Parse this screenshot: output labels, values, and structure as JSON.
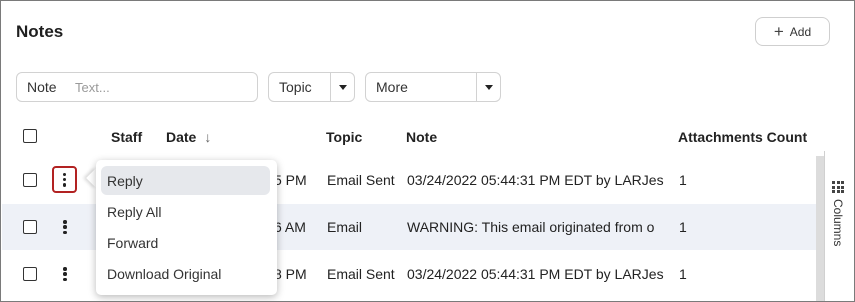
{
  "panel": {
    "title": "Notes",
    "add_label": "Add"
  },
  "filters": {
    "note_label": "Note",
    "note_placeholder": "Text...",
    "topic_label": "Topic",
    "more_label": "More"
  },
  "table": {
    "headers": {
      "staff": "Staff",
      "date": "Date",
      "topic": "Topic",
      "note": "Note",
      "attachments": "Attachments Count"
    },
    "rows": [
      {
        "date": "5 PM",
        "topic": "Email Sent",
        "note": "03/24/2022 05:44:31 PM EDT by LARJes",
        "attachments": "1"
      },
      {
        "date": "6 AM",
        "topic": "Email",
        "note": "WARNING: This email originated from o",
        "attachments": "1"
      },
      {
        "date": "8 PM",
        "topic": "Email Sent",
        "note": "03/24/2022 05:44:31 PM EDT by LARJes",
        "attachments": "1"
      }
    ]
  },
  "context_menu": {
    "items": [
      "Reply",
      "Reply All",
      "Forward",
      "Download Original"
    ]
  },
  "side_panel": {
    "columns_label": "Columns"
  },
  "colors": {
    "highlight_border": "#b22222",
    "alt_row": "#eef1f7",
    "active_menu_item": "#e6e8ec"
  },
  "icons": [
    "plus-icon",
    "chevron-down-icon",
    "arrow-down-icon",
    "more-vertical-icon",
    "grid-icon"
  ]
}
